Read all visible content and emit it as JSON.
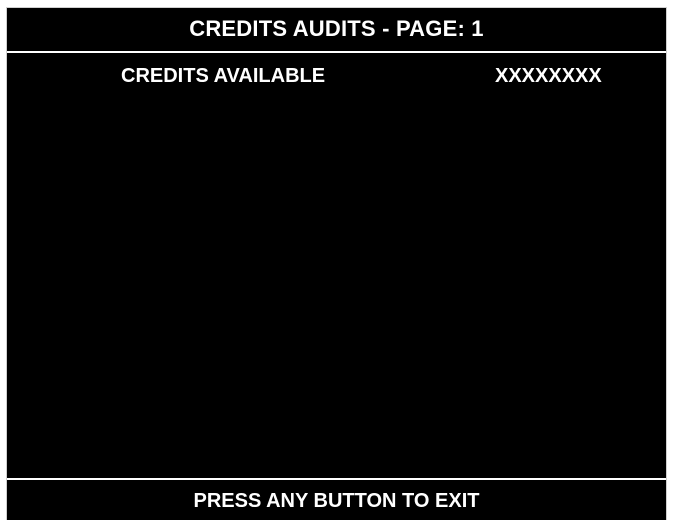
{
  "header": {
    "title": "CREDITS AUDITS - PAGE: 1"
  },
  "audits": [
    {
      "label": "CREDITS AVAILABLE",
      "value": "XXXXXXXX"
    }
  ],
  "footer": {
    "prompt": "PRESS ANY BUTTON TO EXIT"
  },
  "colors": {
    "background": "#000000",
    "text": "#ffffff"
  }
}
